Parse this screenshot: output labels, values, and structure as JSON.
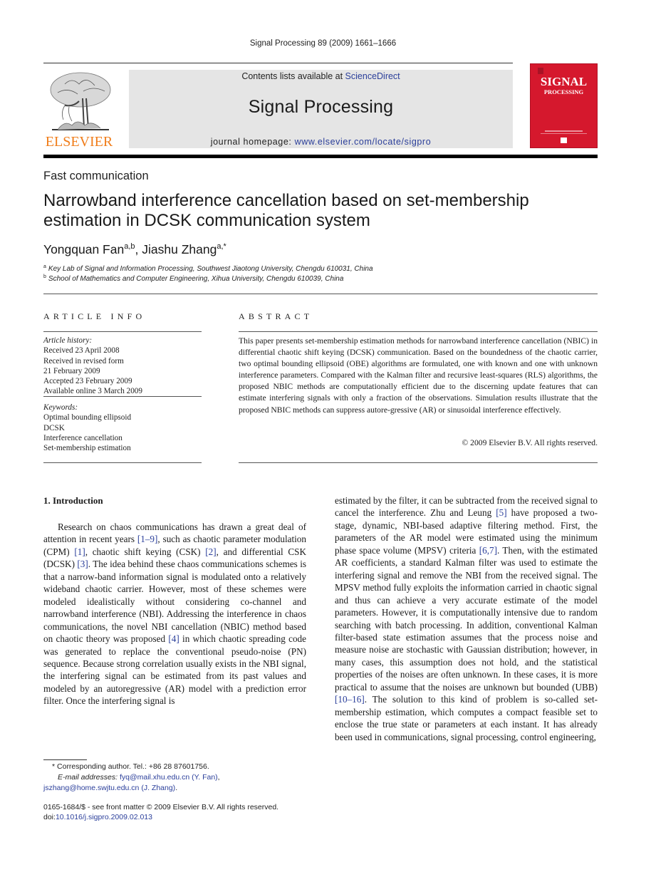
{
  "running_head": "Signal Processing 89 (2009) 1661–1666",
  "masthead": {
    "publisher_logo_text": "ELSEVIER",
    "contents_prefix": "Contents lists available at ",
    "contents_link": "ScienceDirect",
    "journal_name": "Signal Processing",
    "homepage_prefix": "journal homepage: ",
    "homepage_link": "www.elsevier.com/locate/sigpro",
    "cover_title": "SIGNAL",
    "cover_subtitle": "PROCESSING",
    "colors": {
      "cover_red": "#d5182d",
      "elsevier_orange": "#f07d1a",
      "link_blue": "#2a3e9a",
      "box_gray": "#e5e5e5"
    }
  },
  "article": {
    "type": "Fast communication",
    "title": "Narrowband interference cancellation based on set-membership estimation in DCSK communication system",
    "authors": [
      {
        "name": "Yongquan Fan",
        "sup": "a,b",
        "sep": ", "
      },
      {
        "name": "Jiashu Zhang",
        "sup": "a,*",
        "sep": ""
      }
    ],
    "affiliations": [
      {
        "mark": "a",
        "text": "Key Lab of Signal and Information Processing, Southwest Jiaotong University, Chengdu 610031, China"
      },
      {
        "mark": "b",
        "text": "School of Mathematics and Computer Engineering, Xihua University, Chengdu 610039, China"
      }
    ]
  },
  "article_info": {
    "heading": "ARTICLE INFO",
    "history_label": "Article history:",
    "history": [
      "Received 23 April 2008",
      "Received in revised form",
      "21 February 2009",
      "Accepted 23 February 2009",
      "Available online 3 March 2009"
    ],
    "keywords_label": "Keywords:",
    "keywords": [
      "Optimal bounding ellipsoid",
      "DCSK",
      "Interference cancellation",
      "Set-membership estimation"
    ]
  },
  "abstract": {
    "heading": "ABSTRACT",
    "text": "This paper presents set-membership estimation methods for narrowband interference cancellation (NBIC) in differential chaotic shift keying (DCSK) communication. Based on the boundedness of the chaotic carrier, two optimal bounding ellipsoid (OBE) algorithms are formulated, one with known and one with unknown interference parameters. Compared with the Kalman filter and recursive least-squares (RLS) algorithms, the proposed NBIC methods are computationally efficient due to the discerning update features that can estimate interfering signals with only a fraction of the observations. Simulation results illustrate that the proposed NBIC methods can suppress autore-gressive (AR) or sinusoidal interference effectively.",
    "copyright": "© 2009 Elsevier B.V. All rights reserved."
  },
  "body": {
    "section_heading": "1.   Introduction",
    "left_column": [
      {
        "t": "Research on chaos communications has drawn a great deal of attention in recent years "
      },
      {
        "ref": "[1–9]"
      },
      {
        "t": ", such as chaotic parameter modulation (CPM) "
      },
      {
        "ref": "[1]"
      },
      {
        "t": ", chaotic shift keying (CSK) "
      },
      {
        "ref": "[2]"
      },
      {
        "t": ", and differential CSK (DCSK) "
      },
      {
        "ref": "[3]"
      },
      {
        "t": ". The idea behind these chaos communications schemes is that a narrow-band information signal is modulated onto a relatively wideband chaotic carrier. However, most of these schemes were modeled idealistically without considering co-channel and narrowband interference (NBI). Addressing the interference in chaos communications, the novel NBI cancellation (NBIC) method based on chaotic theory was proposed "
      },
      {
        "ref": "[4]"
      },
      {
        "t": " in which chaotic spreading code was generated to replace the conventional pseudo-noise (PN) sequence. Because strong correlation usually exists in the NBI signal, the interfering signal can be estimated from its past values and modeled by an autoregressive (AR) model with a prediction error filter. Once the interfering signal is"
      }
    ],
    "right_column": [
      {
        "t": "estimated by the filter, it can be subtracted from the received signal to cancel the interference. Zhu and Leung "
      },
      {
        "ref": "[5]"
      },
      {
        "t": " have proposed a two-stage, dynamic, NBI-based adaptive filtering method. First, the parameters of the AR model were estimated using the minimum phase space volume (MPSV) criteria "
      },
      {
        "ref": "[6,7]"
      },
      {
        "t": ". Then, with the estimated AR coefficients, a standard Kalman filter was used to estimate the interfering signal and remove the NBI from the received signal. The MPSV method fully exploits the information carried in chaotic signal and thus can achieve a very accurate estimate of the model parameters. However, it is computationally intensive due to random searching with batch processing. In addition, conventional Kalman filter-based state estimation assumes that the process noise and measure noise are stochastic with Gaussian distribution; however, in many cases, this assumption does not hold, and the statistical properties of the noises are often unknown. In these cases, it is more practical to assume that the noises are unknown but bounded (UBB) "
      },
      {
        "ref": "[10–16]"
      },
      {
        "t": ". The solution to this kind of problem is so-called set-membership estimation, which computes a compact feasible set to enclose the true state or parameters at each instant. It has already been used in communications, signal processing, control engineering,"
      }
    ]
  },
  "footnotes": {
    "corresponding_mark": "*",
    "corresponding_text": "Corresponding author. Tel.: +86 28 87601756.",
    "email_label": "E-mail addresses:",
    "emails": [
      {
        "address": "fyq@mail.xhu.edu.cn",
        "owner": "(Y. Fan)",
        "sep": ","
      },
      {
        "address": "jszhang@home.swjtu.edu.cn",
        "owner": "(J. Zhang)",
        "sep": "."
      }
    ],
    "issn_line": "0165-1684/$ - see front matter © 2009 Elsevier B.V. All rights reserved.",
    "doi_prefix": "doi:",
    "doi": "10.1016/j.sigpro.2009.02.013"
  }
}
